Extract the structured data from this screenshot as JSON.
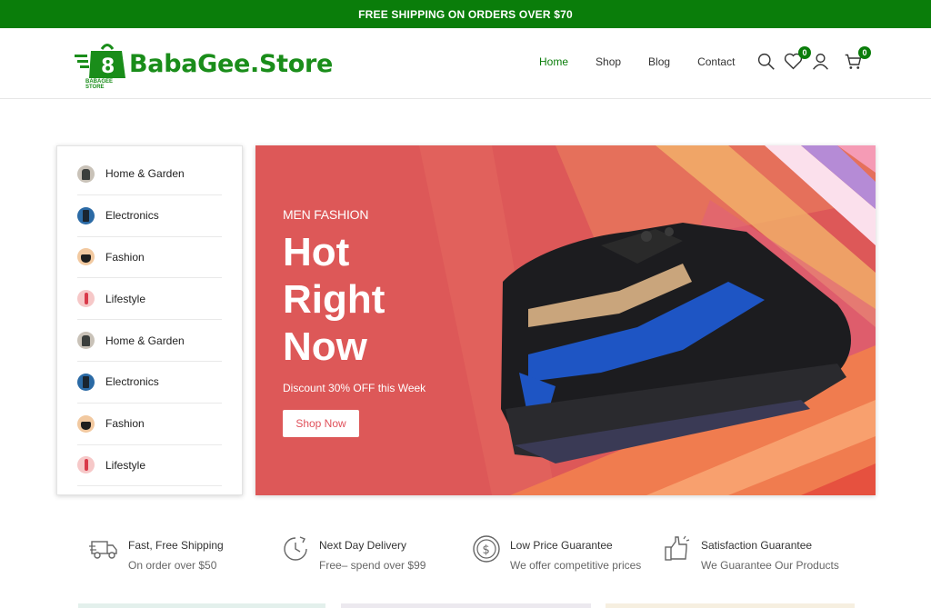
{
  "topbar": {
    "text": "FREE SHIPPING ON ORDERS OVER $70"
  },
  "header": {
    "logo_text": "BabaGee.Store",
    "logo_sub": "BABAGEE STORE",
    "nav": [
      "Home",
      "Shop",
      "Blog",
      "Contact"
    ],
    "wishlist_count": "0",
    "cart_count": "0",
    "icons": [
      "search-icon",
      "heart-icon",
      "user-icon",
      "cart-icon"
    ]
  },
  "sidebar": {
    "items": [
      {
        "label": "Home & Garden",
        "thumb": "garden"
      },
      {
        "label": "Electronics",
        "thumb": "elec"
      },
      {
        "label": "Fashion",
        "thumb": "fashion"
      },
      {
        "label": "Lifestyle",
        "thumb": "life"
      },
      {
        "label": "Home & Garden",
        "thumb": "garden"
      },
      {
        "label": "Electronics",
        "thumb": "elec"
      },
      {
        "label": "Fashion",
        "thumb": "fashion"
      },
      {
        "label": "Lifestyle",
        "thumb": "life"
      }
    ]
  },
  "hero": {
    "tag": "MEN FASHION",
    "title_lines": [
      "Hot",
      "Right",
      "Now"
    ],
    "subtitle": "Discount 30% OFF this Week",
    "button": "Shop Now"
  },
  "features": [
    {
      "title": "Fast, Free Shipping",
      "desc": "On order over $50",
      "icon": "truck-icon"
    },
    {
      "title": "Next Day Delivery",
      "desc": "Free– spend over $99",
      "icon": "clock-icon"
    },
    {
      "title": "Low Price Guarantee",
      "desc": "We offer competitive prices",
      "icon": "dollar-icon"
    },
    {
      "title": "Satisfaction Guarantee",
      "desc": "We Guarantee Our Products",
      "icon": "thumbs-up-icon"
    }
  ],
  "colors": {
    "brand": "#0a7d0a",
    "hero_bg": "#df5a59",
    "button_text": "#e0505a"
  }
}
